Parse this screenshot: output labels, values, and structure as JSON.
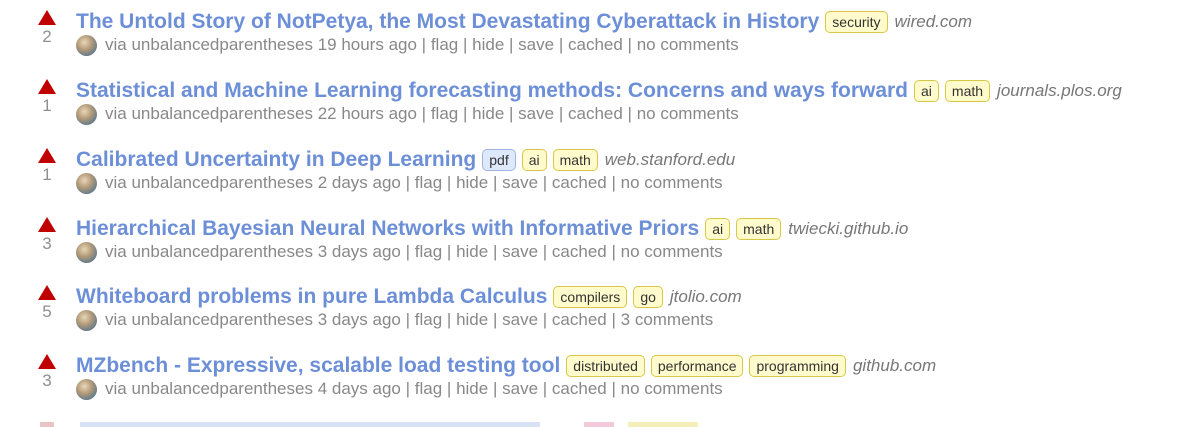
{
  "stories": [
    {
      "score": "2",
      "title": "The Untold Story of NotPetya, the Most Devastating Cyberattack in History",
      "tags": [
        {
          "label": "security",
          "kind": "normal"
        }
      ],
      "domain": "wired.com",
      "via": "via",
      "user": "unbalancedparentheses",
      "time": "19 hours ago",
      "flag": "flag",
      "hide": "hide",
      "save": "save",
      "cached": "cached",
      "comments": "no comments"
    },
    {
      "score": "1",
      "title": "Statistical and Machine Learning forecasting methods: Concerns and ways forward",
      "tags": [
        {
          "label": "ai",
          "kind": "normal"
        },
        {
          "label": "math",
          "kind": "normal"
        }
      ],
      "domain": "journals.plos.org",
      "via": "via",
      "user": "unbalancedparentheses",
      "time": "22 hours ago",
      "flag": "flag",
      "hide": "hide",
      "save": "save",
      "cached": "cached",
      "comments": "no comments"
    },
    {
      "score": "1",
      "title": "Calibrated Uncertainty in Deep Learning",
      "tags": [
        {
          "label": "pdf",
          "kind": "media"
        },
        {
          "label": "ai",
          "kind": "normal"
        },
        {
          "label": "math",
          "kind": "normal"
        }
      ],
      "domain": "web.stanford.edu",
      "via": "via",
      "user": "unbalancedparentheses",
      "time": "2 days ago",
      "flag": "flag",
      "hide": "hide",
      "save": "save",
      "cached": "cached",
      "comments": "no comments"
    },
    {
      "score": "3",
      "title": "Hierarchical Bayesian Neural Networks with Informative Priors",
      "tags": [
        {
          "label": "ai",
          "kind": "normal"
        },
        {
          "label": "math",
          "kind": "normal"
        }
      ],
      "domain": "twiecki.github.io",
      "via": "via",
      "user": "unbalancedparentheses",
      "time": "3 days ago",
      "flag": "flag",
      "hide": "hide",
      "save": "save",
      "cached": "cached",
      "comments": "no comments"
    },
    {
      "score": "5",
      "title": "Whiteboard problems in pure Lambda Calculus",
      "tags": [
        {
          "label": "compilers",
          "kind": "normal"
        },
        {
          "label": "go",
          "kind": "normal"
        }
      ],
      "domain": "jtolio.com",
      "via": "via",
      "user": "unbalancedparentheses",
      "time": "3 days ago",
      "flag": "flag",
      "hide": "hide",
      "save": "save",
      "cached": "cached",
      "comments": "3 comments"
    },
    {
      "score": "3",
      "title": "MZbench - Expressive, scalable load testing tool",
      "tags": [
        {
          "label": "distributed",
          "kind": "normal"
        },
        {
          "label": "performance",
          "kind": "normal"
        },
        {
          "label": "programming",
          "kind": "normal"
        }
      ],
      "domain": "github.com",
      "via": "via",
      "user": "unbalancedparentheses",
      "time": "4 days ago",
      "flag": "flag",
      "hide": "hide",
      "save": "save",
      "cached": "cached",
      "comments": "no comments"
    }
  ],
  "colors": {
    "upvote": "#c00000",
    "title": "#6c8fd8",
    "tag_bg": "#fffbcc",
    "tag_border": "#d9c845",
    "media_tag_bg": "#dde8fb",
    "media_tag_border": "#9eb6de",
    "meta_text": "#888888"
  },
  "icons": {
    "upvote": "upvote-arrow-icon",
    "avatar": "user-avatar"
  }
}
